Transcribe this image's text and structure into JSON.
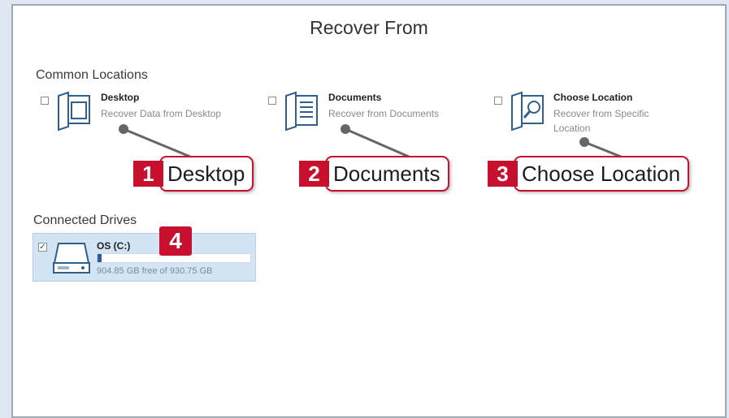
{
  "window": {
    "title": "Recover From"
  },
  "common_locations": {
    "label": "Common Locations",
    "items": [
      {
        "name": "Desktop",
        "description": "Recover Data from Desktop",
        "icon": "desktop-folder-icon",
        "checked": false
      },
      {
        "name": "Documents",
        "description": "Recover from Documents",
        "icon": "documents-icon",
        "checked": false
      },
      {
        "name": "Choose Location",
        "description": "Recover from Specific Location",
        "icon": "search-folder-icon",
        "checked": false
      }
    ]
  },
  "connected_drives": {
    "label": "Connected Drives",
    "items": [
      {
        "name": "OS (C:)",
        "free_text": "904.85 GB free of 930.75 GB",
        "used_fraction": 0.028,
        "checked": true,
        "icon": "hard-drive-icon"
      }
    ]
  },
  "callouts": [
    {
      "number": "1",
      "label": "Desktop"
    },
    {
      "number": "2",
      "label": "Documents"
    },
    {
      "number": "3",
      "label": "Choose Location"
    },
    {
      "number": "4"
    }
  ],
  "colors": {
    "callout": "#c8102e",
    "drive_selected_bg": "#d3e4f4",
    "drive_bar": "#2a5d9a",
    "frame_bg": "#dfe8f1"
  }
}
